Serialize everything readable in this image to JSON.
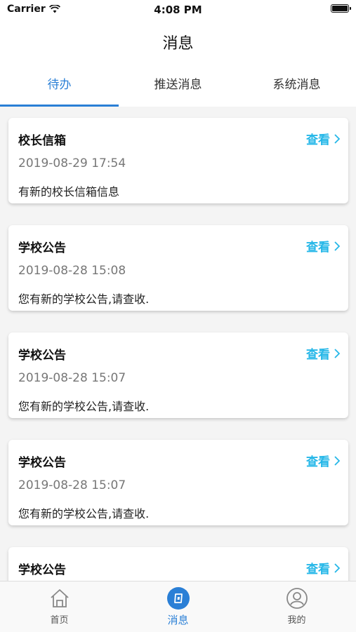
{
  "status": {
    "carrier": "Carrier",
    "time": "4:08 PM"
  },
  "nav": {
    "title": "消息"
  },
  "tabs": [
    {
      "label": "待办",
      "active": true
    },
    {
      "label": "推送消息",
      "active": false
    },
    {
      "label": "系统消息",
      "active": false
    }
  ],
  "view_label": "查看",
  "cards": [
    {
      "title": "校长信箱",
      "date": "2019-08-29 17:54",
      "desc": "有新的校长信箱信息"
    },
    {
      "title": "学校公告",
      "date": "2019-08-28 15:08",
      "desc": "您有新的学校公告,请查收."
    },
    {
      "title": "学校公告",
      "date": "2019-08-28 15:07",
      "desc": "您有新的学校公告,请查收."
    },
    {
      "title": "学校公告",
      "date": "2019-08-28 15:07",
      "desc": "您有新的学校公告,请查收."
    },
    {
      "title": "学校公告",
      "date": "",
      "desc": ""
    }
  ],
  "tabbar": [
    {
      "label": "首页",
      "icon": "home-icon"
    },
    {
      "label": "消息",
      "icon": "message-icon"
    },
    {
      "label": "我的",
      "icon": "profile-icon"
    }
  ],
  "colors": {
    "accent": "#2a7fd6",
    "link": "#25b7e8"
  }
}
